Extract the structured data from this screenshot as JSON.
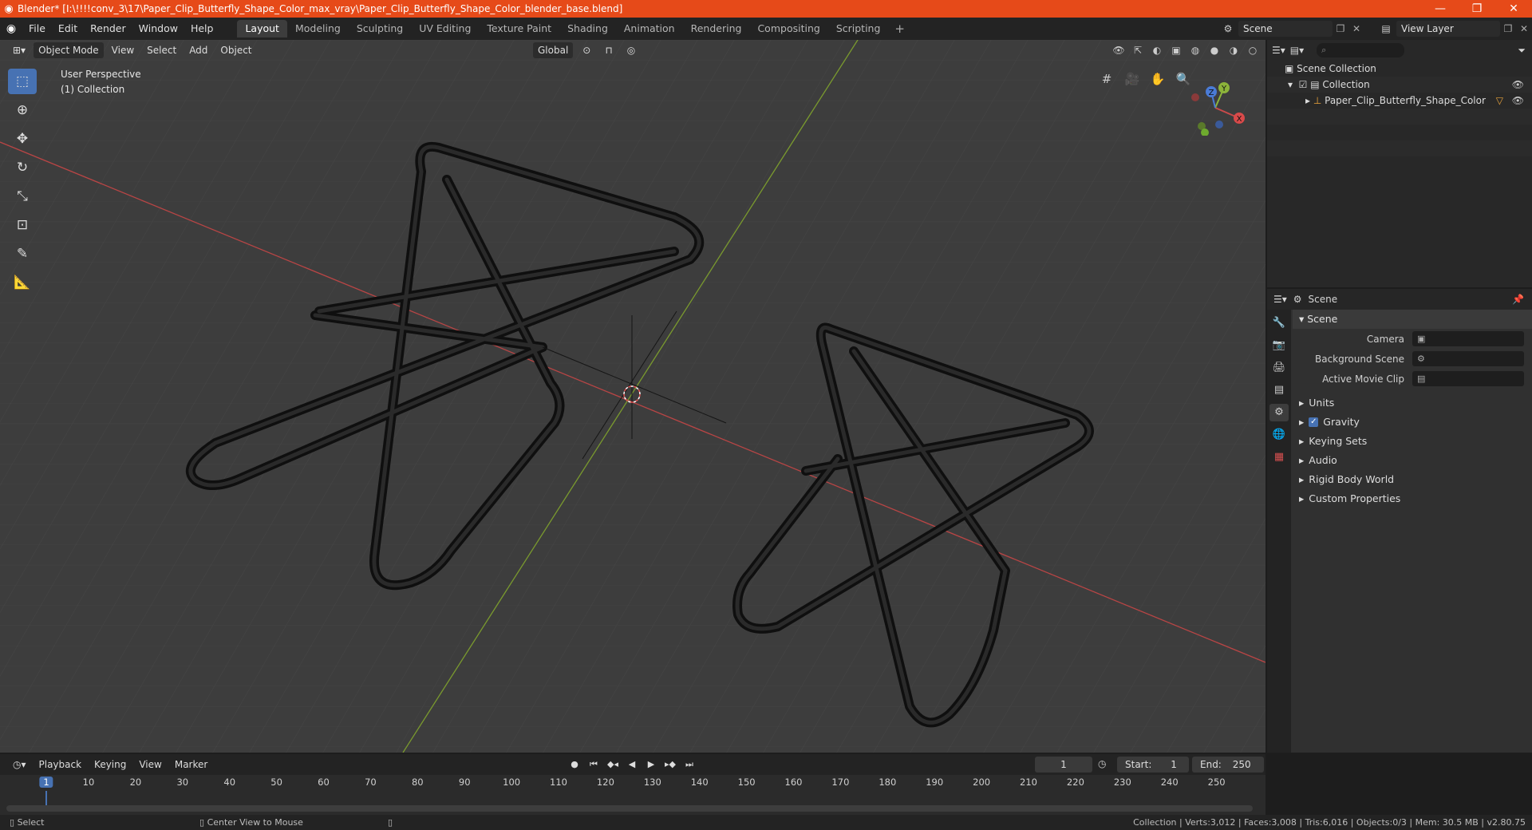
{
  "window": {
    "title": "Blender* [I:\\!!!!conv_3\\17\\Paper_Clip_Butterfly_Shape_Color_max_vray\\Paper_Clip_Butterfly_Shape_Color_blender_base.blend]",
    "minimize": "—",
    "maximize": "❐",
    "close": "✕"
  },
  "menu": {
    "items": [
      "File",
      "Edit",
      "Render",
      "Window",
      "Help"
    ]
  },
  "workspaces": {
    "tabs": [
      "Layout",
      "Modeling",
      "Sculpting",
      "UV Editing",
      "Texture Paint",
      "Shading",
      "Animation",
      "Rendering",
      "Compositing",
      "Scripting"
    ],
    "active": "Layout"
  },
  "scene_selector": {
    "value": "Scene"
  },
  "view_layer_selector": {
    "value": "View Layer"
  },
  "viewport": {
    "mode": "Object Mode",
    "menus": [
      "View",
      "Select",
      "Add",
      "Object"
    ],
    "transform_orientation": "Global",
    "perspective": "User Perspective",
    "collection": "(1) Collection",
    "gizmo": {
      "x": "X",
      "y": "Y",
      "z": "Z"
    }
  },
  "outliner": {
    "rows": [
      {
        "label": "Scene Collection"
      },
      {
        "label": "Collection"
      },
      {
        "label": "Paper_Clip_Butterfly_Shape_Color"
      }
    ]
  },
  "properties": {
    "header_label": "Scene",
    "panel_title": "Scene",
    "fields": [
      {
        "label": "Camera"
      },
      {
        "label": "Background Scene"
      },
      {
        "label": "Active Movie Clip"
      }
    ],
    "subpanels": [
      "Units",
      "Gravity",
      "Keying Sets",
      "Audio",
      "Rigid Body World",
      "Custom Properties"
    ]
  },
  "timeline": {
    "menus": [
      "Playback",
      "Keying",
      "View",
      "Marker"
    ],
    "current_frame": "1",
    "start_label": "Start:",
    "start": "1",
    "end_label": "End:",
    "end": "250",
    "ticks": [
      "1",
      "10",
      "20",
      "30",
      "40",
      "50",
      "60",
      "70",
      "80",
      "90",
      "100",
      "110",
      "120",
      "130",
      "140",
      "150",
      "160",
      "170",
      "180",
      "190",
      "200",
      "210",
      "220",
      "230",
      "240",
      "250"
    ]
  },
  "statusbar": {
    "select": "Select",
    "center_view": "Center View to Mouse",
    "stats": "Collection | Verts:3,012 | Faces:3,008 | Tris:6,016 | Objects:0/3 | Mem: 30.5 MB | v2.80.75"
  },
  "colors": {
    "title_bar": "#e64a19",
    "accent": "#4772b3",
    "viewport_bg": "#3d3d3d",
    "x_axis": "#c94a4a",
    "y_axis": "#8cb43a"
  }
}
